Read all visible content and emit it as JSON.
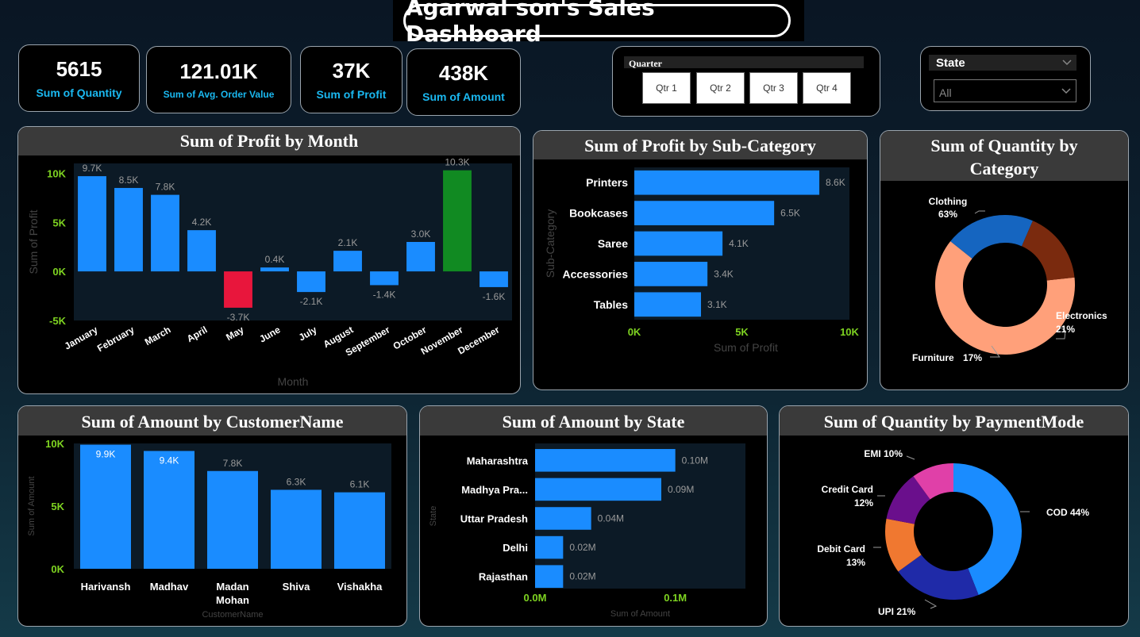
{
  "title": "Agarwal son's Sales  Dashboard",
  "kpis": [
    {
      "value": "5615",
      "label": "Sum of Quantity"
    },
    {
      "value": "121.01K",
      "label": "Sum of Avg. Order Value"
    },
    {
      "value": "37K",
      "label": "Sum of Profit"
    },
    {
      "value": "438K",
      "label": "Sum of Amount"
    }
  ],
  "quarter_slicer": {
    "label": "Quarter",
    "options": [
      "Qtr 1",
      "Qtr 2",
      "Qtr 3",
      "Qtr 4"
    ]
  },
  "state_slicer": {
    "label": "State",
    "value": "All"
  },
  "colors": {
    "accent": "#1a8cff",
    "negative": "#e8163c",
    "total": "#118a22",
    "kpi_label": "#1ab8f0",
    "axis_green": "#7ed321"
  },
  "chart_data": [
    {
      "type": "bar",
      "title": "Sum of Profit by Month",
      "xlabel": "Month",
      "ylabel": "Sum of Profit",
      "categories": [
        "January",
        "February",
        "March",
        "April",
        "May",
        "June",
        "July",
        "August",
        "September",
        "October",
        "November",
        "December"
      ],
      "values": [
        9700,
        8500,
        7800,
        4200,
        -3700,
        400,
        -2100,
        2100,
        -1400,
        3000,
        10300,
        -1600
      ],
      "data_labels": [
        "9.7K",
        "8.5K",
        "7.8K",
        "4.2K",
        "-3.7K",
        "0.4K",
        "-2.1K",
        "2.1K",
        "-1.4K",
        "3.0K",
        "10.3K",
        "-1.6K"
      ],
      "ylim": [
        -5000,
        11000
      ],
      "yticks": [
        "10K",
        "5K",
        "0K",
        "-5K"
      ]
    },
    {
      "type": "bar",
      "title": "Sum of Profit by Sub-Category",
      "xlabel": "Sum of Profit",
      "ylabel": "Sub-Category",
      "categories": [
        "Printers",
        "Bookcases",
        "Saree",
        "Accessories",
        "Tables"
      ],
      "values": [
        8600,
        6500,
        4100,
        3400,
        3100
      ],
      "data_labels": [
        "8.6K",
        "6.5K",
        "4.1K",
        "3.4K",
        "3.1K"
      ],
      "xlim": [
        0,
        10000
      ],
      "xticks": [
        "0K",
        "5K",
        "10K"
      ]
    },
    {
      "type": "pie",
      "title": "Sum of Quantity by Category",
      "slices": [
        {
          "name": "Clothing",
          "value": 63,
          "label": "63%",
          "color": "#ffa07a"
        },
        {
          "name": "Electronics",
          "value": 21,
          "label": "21%",
          "color": "#1565c0"
        },
        {
          "name": "Furniture",
          "value": 17,
          "label": "17%",
          "color": "#7a2a0e"
        }
      ]
    },
    {
      "type": "bar",
      "title": "Sum of Amount by CustomerName",
      "xlabel": "CustomerName",
      "ylabel": "Sum of Amount",
      "categories": [
        "Harivansh",
        "Madhav",
        "Madan Mohan",
        "Shiva",
        "Vishakha"
      ],
      "values": [
        9900,
        9400,
        7800,
        6300,
        6100
      ],
      "data_labels": [
        "9.9K",
        "9.4K",
        "7.8K",
        "6.3K",
        "6.1K"
      ],
      "ylim": [
        0,
        10000
      ],
      "yticks": [
        "10K",
        "5K",
        "0K"
      ]
    },
    {
      "type": "bar",
      "title": "Sum of Amount by State",
      "xlabel": "Sum of Amount",
      "ylabel": "State",
      "categories": [
        "Maharashtra",
        "Madhya Pra...",
        "Uttar Pradesh",
        "Delhi",
        "Rajasthan"
      ],
      "values": [
        0.1,
        0.09,
        0.04,
        0.02,
        0.02
      ],
      "data_labels": [
        "0.10M",
        "0.09M",
        "0.04M",
        "0.02M",
        "0.02M"
      ],
      "xlim": [
        0,
        0.15
      ],
      "xticks": [
        "0.0M",
        "0.1M"
      ]
    },
    {
      "type": "pie",
      "title": "Sum of Quantity by PaymentMode",
      "slices": [
        {
          "name": "COD",
          "value": 44,
          "label": "COD 44%",
          "color": "#1a8cff"
        },
        {
          "name": "UPI",
          "value": 21,
          "label": "UPI 21%",
          "color": "#1f2aa8"
        },
        {
          "name": "Debit Card",
          "value": 13,
          "label": "13%",
          "color": "#f07830"
        },
        {
          "name": "Credit Card",
          "value": 12,
          "label": "12%",
          "color": "#6a0f8c"
        },
        {
          "name": "EMI",
          "value": 10,
          "label": "EMI 10%",
          "color": "#e040a8"
        }
      ]
    }
  ]
}
